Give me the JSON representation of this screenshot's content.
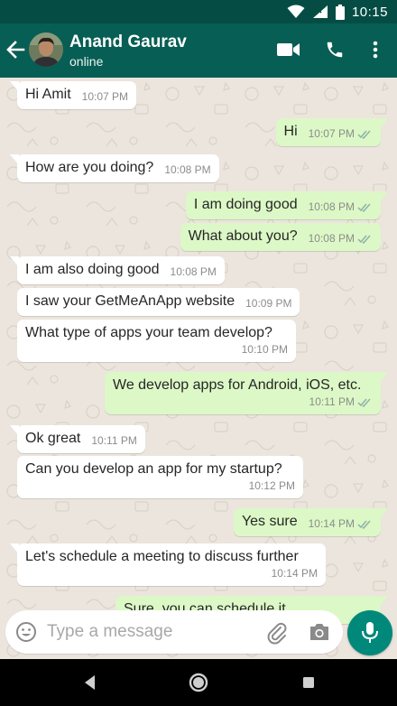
{
  "status_bar": {
    "time": "10:15"
  },
  "contact": {
    "name": "Anand Gaurav",
    "status": "online"
  },
  "messages": [
    {
      "dir": "in",
      "text": "Hi Amit",
      "time": "10:07 PM"
    },
    {
      "dir": "out",
      "text": "Hi",
      "time": "10:07 PM"
    },
    {
      "dir": "in",
      "text": "How are you doing?",
      "time": "10:08 PM"
    },
    {
      "dir": "out",
      "text": "I am doing good",
      "time": "10:08 PM"
    },
    {
      "dir": "out",
      "text": "What about you?",
      "time": "10:08 PM"
    },
    {
      "dir": "in",
      "text": "I am also doing good",
      "time": "10:08 PM"
    },
    {
      "dir": "in",
      "text": "I saw your GetMeAnApp website",
      "time": "10:09 PM"
    },
    {
      "dir": "in",
      "text": "What type of apps your team develop?",
      "time": "10:10 PM"
    },
    {
      "dir": "out",
      "text": "We develop apps for Android, iOS, etc.",
      "time": "10:11 PM"
    },
    {
      "dir": "in",
      "text": "Ok great",
      "time": "10:11 PM"
    },
    {
      "dir": "in",
      "text": "Can you develop an app for my startup?",
      "time": "10:12 PM"
    },
    {
      "dir": "out",
      "text": "Yes sure",
      "time": "10:14 PM"
    },
    {
      "dir": "in",
      "text": "Let's schedule a meeting to discuss further",
      "time": "10:14 PM"
    },
    {
      "dir": "out",
      "text": "Sure, you can schedule it",
      "time": ""
    }
  ],
  "composer": {
    "placeholder": "Type a message",
    "value": ""
  },
  "colors": {
    "header": "#075e54",
    "status_bar": "#054d44",
    "outgoing_bubble": "#dcf8c6",
    "incoming_bubble": "#ffffff",
    "tick_read": "#8fb2a8",
    "mic_button": "#00897b"
  },
  "icons": {
    "header": [
      "back-arrow-icon",
      "video-call-icon",
      "phone-icon",
      "more-vert-icon"
    ],
    "composer": [
      "emoji-icon",
      "attach-icon",
      "camera-icon",
      "mic-icon"
    ],
    "status": [
      "wifi-icon",
      "signal-icon",
      "battery-icon"
    ],
    "nav": [
      "nav-back-icon",
      "nav-home-icon",
      "nav-recents-icon"
    ]
  }
}
